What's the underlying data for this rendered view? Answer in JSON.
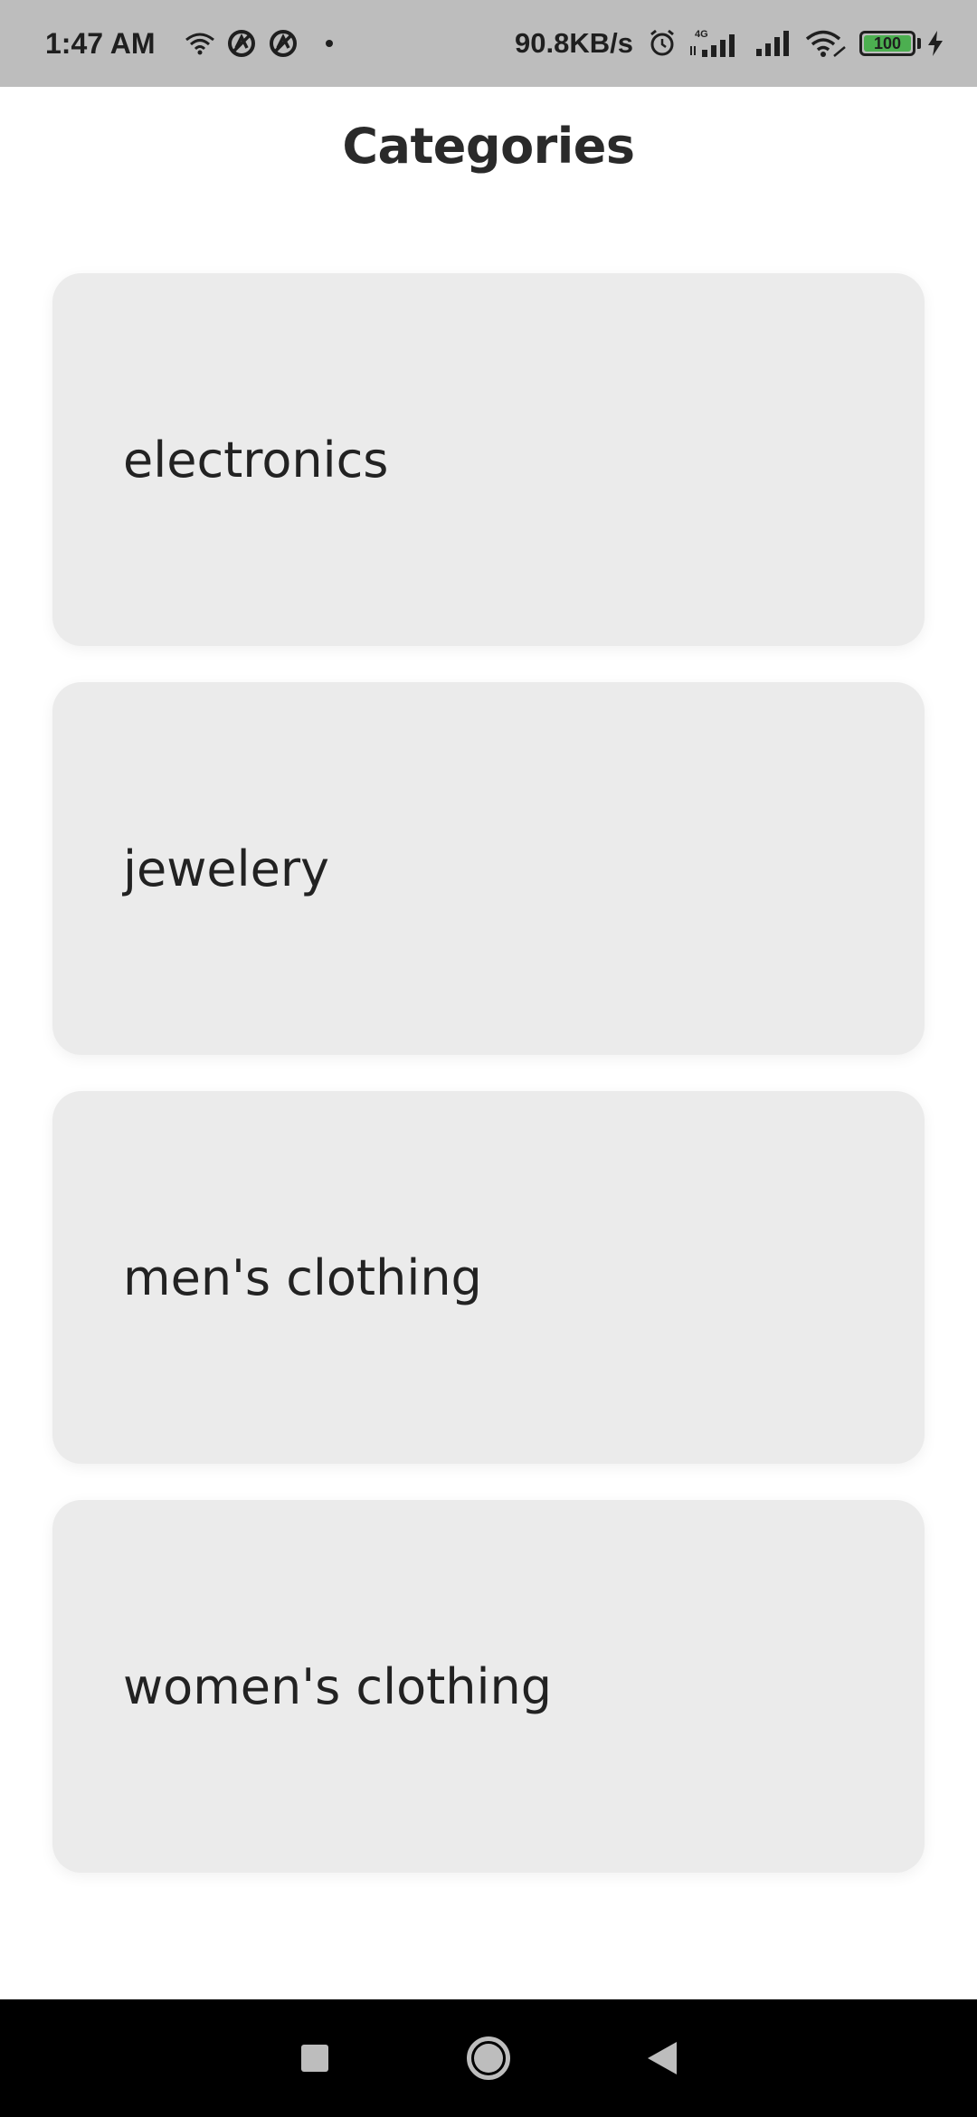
{
  "status_bar": {
    "time": "1:47 AM",
    "network_speed": "90.8KB/s",
    "battery_level": "100",
    "battery_percent": 100,
    "icons": [
      "wifi-icon",
      "app-notification-icon",
      "app-notification-icon",
      "dot-icon",
      "alarm-icon",
      "signal-4g-icon",
      "signal-icon",
      "wifi-icon",
      "battery-icon",
      "charging-icon"
    ]
  },
  "header": {
    "title": "Categories"
  },
  "categories": [
    {
      "label": "electronics"
    },
    {
      "label": "jewelery"
    },
    {
      "label": "men's clothing"
    },
    {
      "label": "women's clothing"
    }
  ],
  "nav_bar": {
    "buttons": [
      "recent-apps",
      "home",
      "back"
    ]
  },
  "colors": {
    "status_bar_bg": "#bdbdbd",
    "card_bg": "#ebebeb",
    "text": "#222222",
    "nav_bg": "#000000",
    "battery_fill": "#4caf50"
  }
}
